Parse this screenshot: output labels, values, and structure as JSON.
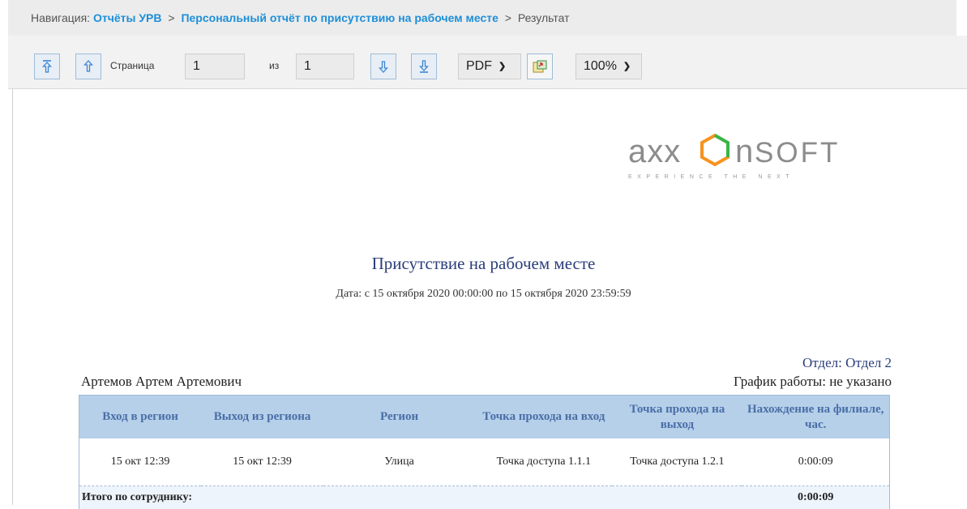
{
  "nav": {
    "prefix": "Навигация:",
    "crumbs": [
      "Отчёты УРВ",
      "Персональный отчёт по присутствию на рабочем месте"
    ],
    "separator": ">",
    "current": "Результат"
  },
  "toolbar": {
    "first_page_icon": "first-page-icon",
    "prev_page_icon": "prev-page-icon",
    "page_label": "Страница",
    "page_value": "1",
    "of_label": "из",
    "total_pages": "1",
    "next_page_icon": "next-page-icon",
    "last_page_icon": "last-page-icon",
    "format_value": "PDF",
    "export_icon": "export-icon",
    "zoom_value": "100%"
  },
  "colors": {
    "accent": "#1e8fd8",
    "table_header_bg": "#b6d0ea",
    "table_header_text": "#4a6ea6",
    "title_text": "#2a3d7a",
    "logo_orange": "#f7931e",
    "logo_green": "#39b54a",
    "logo_gray": "#8c8c8c"
  },
  "logo": {
    "brand_left": "axx",
    "brand_right": "nsoft",
    "brand_right_caps": "SOFT",
    "tagline": "EXPERIENCE THE NEXT"
  },
  "report": {
    "title": "Присутствие на рабочем месте",
    "date_range": "Дата: с 15 октября 2020 00:00:00 по 15 октября 2020 23:59:59",
    "department": "Отдел: Отдел 2",
    "employee": "Артемов Артем Артемович",
    "schedule": "График работы: не указано",
    "columns": [
      "Вход в регион",
      "Выход из региона",
      "Регион",
      "Точка прохода на вход",
      "Точка прохода на выход",
      "Нахождение на филиале, час."
    ],
    "rows": [
      [
        "15 окт 12:39",
        "15 окт 12:39",
        "Улица",
        "Точка доступа 1.1.1",
        "Точка доступа 1.2.1",
        "0:00:09"
      ]
    ],
    "total_label": "Итого по сотруднику:",
    "total_value": "0:00:09"
  }
}
